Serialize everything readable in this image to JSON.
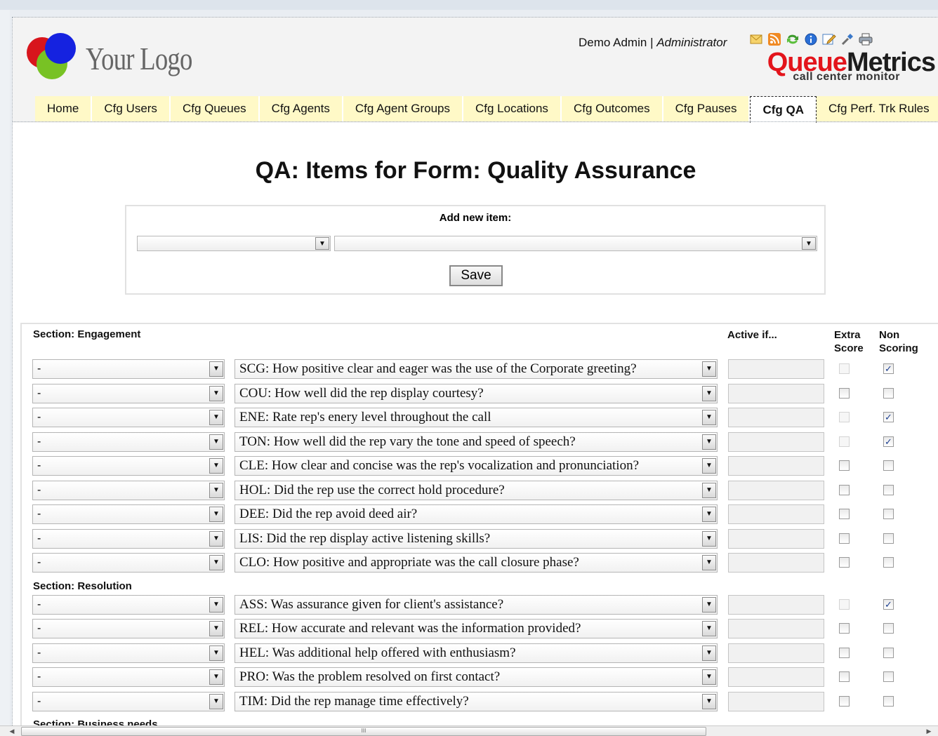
{
  "header": {
    "logo_text": "Your Logo",
    "user_name": "Demo Admin",
    "separator": "|",
    "user_role": "Administrator",
    "brand_part1": "Queue",
    "brand_part2": "Metrics",
    "brand_sub": "call center monitor",
    "toolbar_icons": [
      "mail-icon",
      "rss-icon",
      "refresh-icon",
      "info-icon",
      "edit-note-icon",
      "tools-icon",
      "print-icon"
    ]
  },
  "tabs": [
    {
      "label": "Home",
      "active": false
    },
    {
      "label": "Cfg Users",
      "active": false
    },
    {
      "label": "Cfg Queues",
      "active": false
    },
    {
      "label": "Cfg Agents",
      "active": false
    },
    {
      "label": "Cfg Agent Groups",
      "active": false
    },
    {
      "label": "Cfg Locations",
      "active": false
    },
    {
      "label": "Cfg Outcomes",
      "active": false
    },
    {
      "label": "Cfg Pauses",
      "active": false
    },
    {
      "label": "Cfg QA",
      "active": true
    },
    {
      "label": "Cfg Perf. Trk Rules",
      "active": false
    }
  ],
  "main": {
    "title": "QA: Items for Form: Quality Assurance",
    "add_item_label": "Add new item:",
    "save_label": "Save",
    "col_active_if": "Active if...",
    "col_extra_score": [
      "Extra",
      "Score"
    ],
    "col_non_scoring": [
      "Non",
      "Scoring"
    ]
  },
  "sections": [
    {
      "title": "Section: Engagement",
      "items": [
        {
          "cat": "-",
          "question": "SCG: How positive clear and eager was the use of the Corporate greeting?",
          "extra_disabled": true,
          "extra": false,
          "nonscoring": true
        },
        {
          "cat": "-",
          "question": "COU: How well did the rep display courtesy?",
          "extra_disabled": false,
          "extra": false,
          "nonscoring": false
        },
        {
          "cat": "-",
          "question": "ENE: Rate rep's enery level throughout the call",
          "extra_disabled": true,
          "extra": false,
          "nonscoring": true
        },
        {
          "cat": "-",
          "question": "TON: How well did the rep vary the tone and speed of speech?",
          "extra_disabled": true,
          "extra": false,
          "nonscoring": true
        },
        {
          "cat": "-",
          "question": "CLE: How clear and concise was the rep's vocalization and pronunciation?",
          "extra_disabled": false,
          "extra": false,
          "nonscoring": false
        },
        {
          "cat": "-",
          "question": "HOL: Did the rep use the correct hold procedure?",
          "extra_disabled": false,
          "extra": false,
          "nonscoring": false
        },
        {
          "cat": "-",
          "question": "DEE: Did the rep avoid deed air?",
          "extra_disabled": false,
          "extra": false,
          "nonscoring": false
        },
        {
          "cat": "-",
          "question": "LIS: Did the rep display active listening skills?",
          "extra_disabled": false,
          "extra": false,
          "nonscoring": false
        },
        {
          "cat": "-",
          "question": "CLO: How positive and appropriate was the call closure phase?",
          "extra_disabled": false,
          "extra": false,
          "nonscoring": false
        }
      ]
    },
    {
      "title": "Section: Resolution",
      "items": [
        {
          "cat": "-",
          "question": "ASS: Was assurance given for client's assistance?",
          "extra_disabled": true,
          "extra": false,
          "nonscoring": true
        },
        {
          "cat": "-",
          "question": "REL: How accurate and relevant was the information provided?",
          "extra_disabled": false,
          "extra": false,
          "nonscoring": false
        },
        {
          "cat": "-",
          "question": "HEL: Was additional help offered with enthusiasm?",
          "extra_disabled": false,
          "extra": false,
          "nonscoring": false
        },
        {
          "cat": "-",
          "question": "PRO: Was the problem resolved on first contact?",
          "extra_disabled": false,
          "extra": false,
          "nonscoring": false
        },
        {
          "cat": "-",
          "question": "TIM: Did the rep manage time effectively?",
          "extra_disabled": false,
          "extra": false,
          "nonscoring": false
        }
      ]
    },
    {
      "title": "Section: Business needs",
      "items": []
    }
  ],
  "scrollbar": {
    "thumb_label": "III"
  }
}
